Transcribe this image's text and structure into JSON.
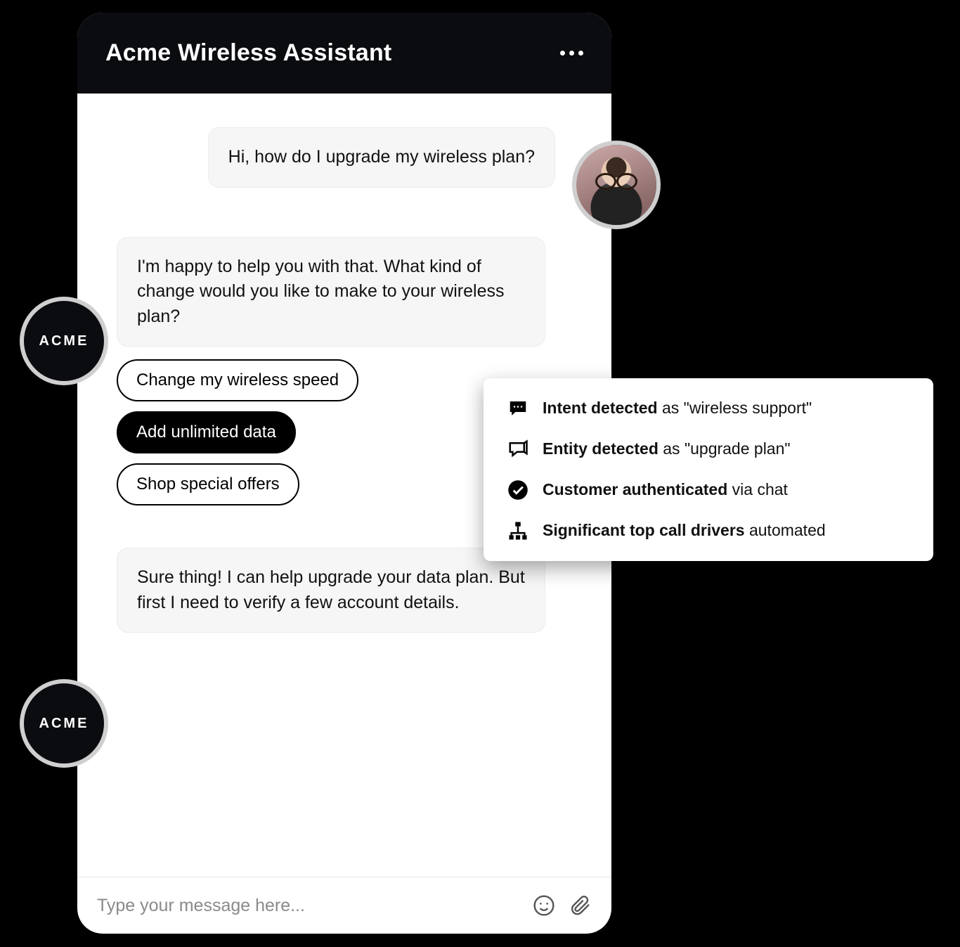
{
  "header": {
    "title": "Acme Wireless Assistant"
  },
  "avatars": {
    "assistant_label": "ACME"
  },
  "messages": {
    "user1": "Hi, how do I upgrade my wireless plan?",
    "assistant1": "I'm happy to help you with that. What kind of change would you like to make to your wireless plan?",
    "assistant2": "Sure thing! I can help upgrade your data plan. But first I need to verify a few account details."
  },
  "chips": [
    {
      "label": "Change my wireless speed",
      "selected": false
    },
    {
      "label": "Add unlimited data",
      "selected": true
    },
    {
      "label": "Shop special offers",
      "selected": false
    }
  ],
  "input": {
    "placeholder": "Type your message here..."
  },
  "callout": [
    {
      "bold": "Intent detected",
      "rest": " as \"wireless support\""
    },
    {
      "bold": "Entity detected",
      "rest": " as \"upgrade plan\""
    },
    {
      "bold": "Customer authenticated",
      "rest": " via chat"
    },
    {
      "bold": "Significant top call drivers",
      "rest": " automated"
    }
  ]
}
